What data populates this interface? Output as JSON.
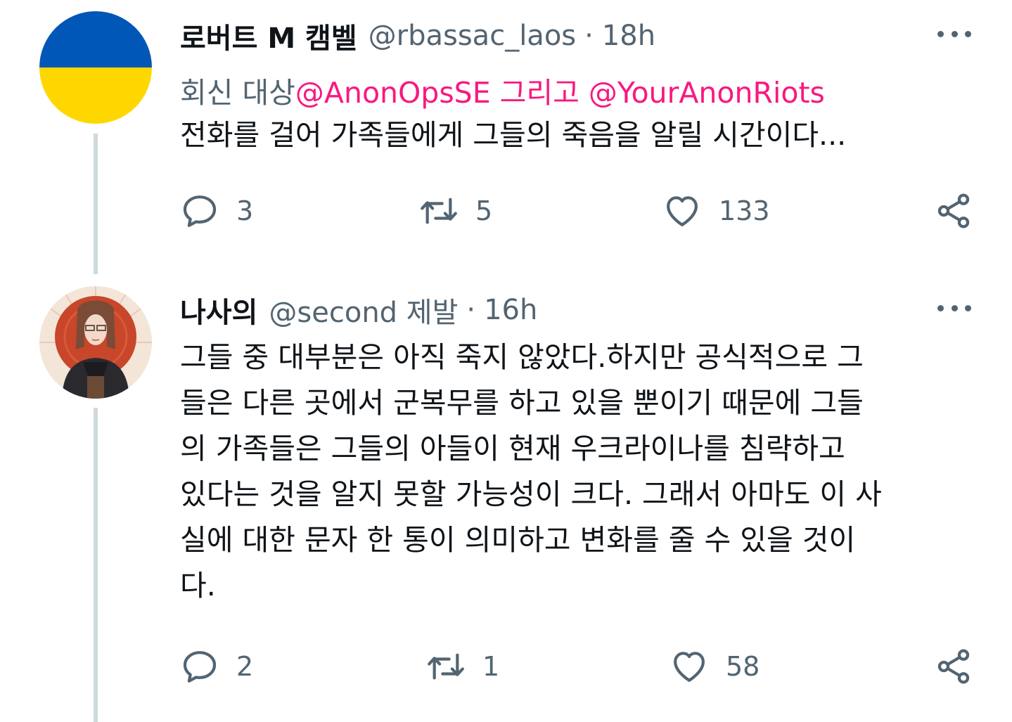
{
  "tweets": [
    {
      "name": "로버트 M 캠벨",
      "handle": "@rbassac_laos",
      "separator": "·",
      "time": "18h",
      "reply_prefix": "회신 대상",
      "mention_1": "@AnonOpsSE",
      "reply_joiner": " 그리고 ",
      "mention_2": "@YourAnonRiots",
      "text": "전화를 걸어 가족들에게 그들의 죽음을 알릴 시간이다...",
      "reply_count": "3",
      "retweet_count": "5",
      "like_count": "133",
      "avatar": "ukraine-flag-avatar",
      "avatar_colors": {
        "top": "#0057b7",
        "bottom": "#ffd700"
      }
    },
    {
      "name": "나사의",
      "handle": "@second 제발",
      "separator": "·",
      "time": "16h",
      "text": "그들 중 대부분은 아직 죽지 않았다.하지만 공식적으로 그\n들은 다른 곳에서 군복무를 하고 있을 뿐이기 때문에 그들\n의 가족들은 그들의 아들이 현재 우크라이나를 침략하고\n있다는 것을 알지 못할 가능성이 크다. 그래서 아마도 이 사\n실에 대한 문자 한 통이 의미하고 변화를 줄 수 있을 것이\n다.",
      "reply_count": "2",
      "retweet_count": "1",
      "like_count": "58",
      "avatar": "illustrated-person-avatar",
      "avatar_colors": {
        "background": "#c8462a",
        "ring": "#f3e6d8"
      }
    }
  ],
  "colors": {
    "text": "#0f1419",
    "secondary": "#536471",
    "mention": "#f91880",
    "thread_line": "#cfd9de"
  },
  "icons": {
    "reply": "reply-icon",
    "retweet": "retweet-icon",
    "like": "heart-icon",
    "share": "share-icon",
    "more": "more-options-icon"
  }
}
